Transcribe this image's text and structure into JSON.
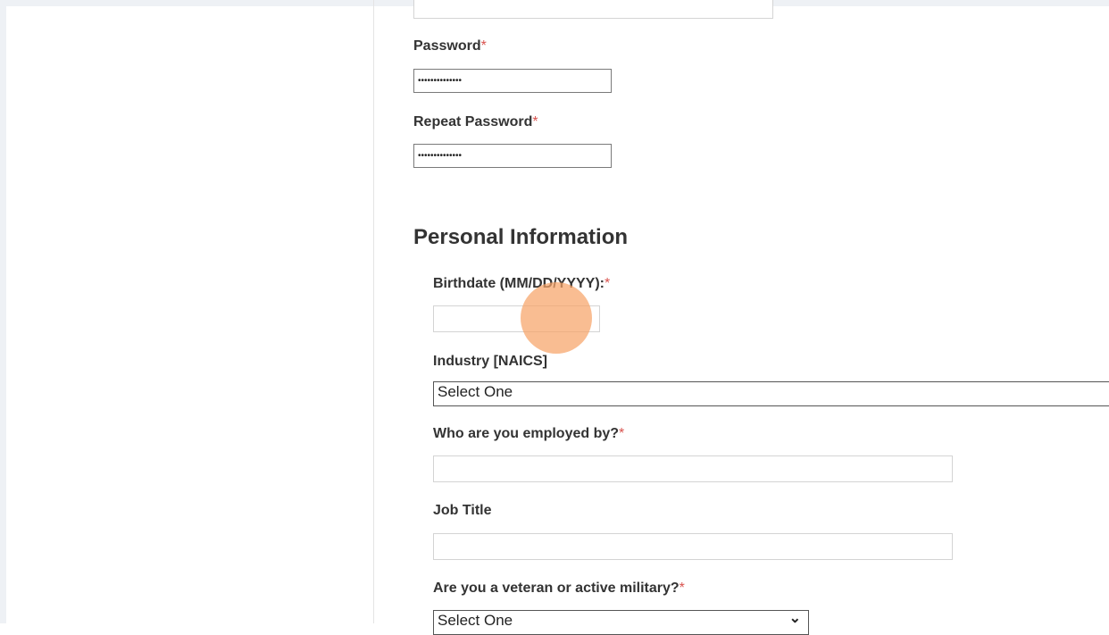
{
  "form": {
    "username_value": "",
    "password": {
      "label": "Password",
      "required_mark": "*",
      "value": "••••••••••••••"
    },
    "repeat_password": {
      "label": "Repeat Password",
      "required_mark": "*",
      "value": "••••••••••••••"
    }
  },
  "personal": {
    "title": "Personal Information",
    "birthdate": {
      "label": "Birthdate (MM/DD/YYYY):",
      "required_mark": "*",
      "value": ""
    },
    "industry": {
      "label": "Industry [NAICS]",
      "selected": "Select One"
    },
    "employer": {
      "label": "Who are you employed by?",
      "required_mark": "*",
      "value": ""
    },
    "job_title": {
      "label": "Job Title",
      "value": ""
    },
    "veteran": {
      "label": "Are you a veteran or active military?",
      "required_mark": "*",
      "selected": "Select One"
    }
  },
  "icons": {
    "dropdown": "chevron-down-icon",
    "pointer": "click-cursor-indicator"
  },
  "colors": {
    "required": "#d9534f",
    "cursor_highlight": "#f6a468"
  }
}
